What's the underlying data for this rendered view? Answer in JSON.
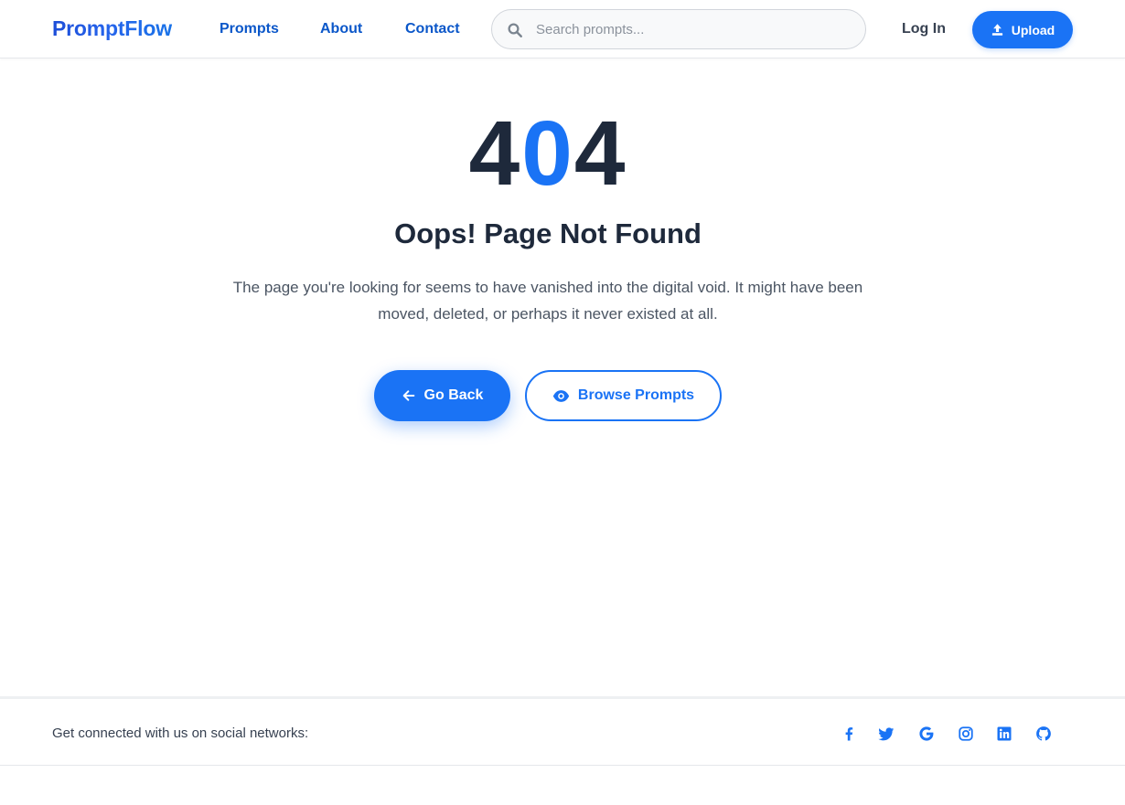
{
  "header": {
    "brand": "PromptFlow",
    "nav": [
      {
        "label": "Prompts"
      },
      {
        "label": "About"
      },
      {
        "label": "Contact"
      }
    ],
    "search": {
      "placeholder": "Search prompts...",
      "value": ""
    },
    "login_label": "Log In",
    "upload_label": "Upload",
    "icons": {
      "search": "search-icon",
      "upload": "upload-icon"
    }
  },
  "main": {
    "code_left": "4",
    "code_middle": "0",
    "code_right": "4",
    "title": "Oops! Page Not Found",
    "message": "The page you're looking for seems to have vanished into the digital void. It might have been moved, deleted, or perhaps it never existed at all.",
    "back_label": "Go Back",
    "browse_label": "Browse Prompts"
  },
  "footer": {
    "text": "Get connected with us on social networks:",
    "socials": [
      "facebook-icon",
      "twitter-icon",
      "google-icon",
      "instagram-icon",
      "linkedin-icon",
      "github-icon"
    ]
  },
  "colors": {
    "accent": "#1a73f5",
    "nav_link": "#0b57c9",
    "heading": "#1e293b",
    "body_text": "#4b5563"
  }
}
